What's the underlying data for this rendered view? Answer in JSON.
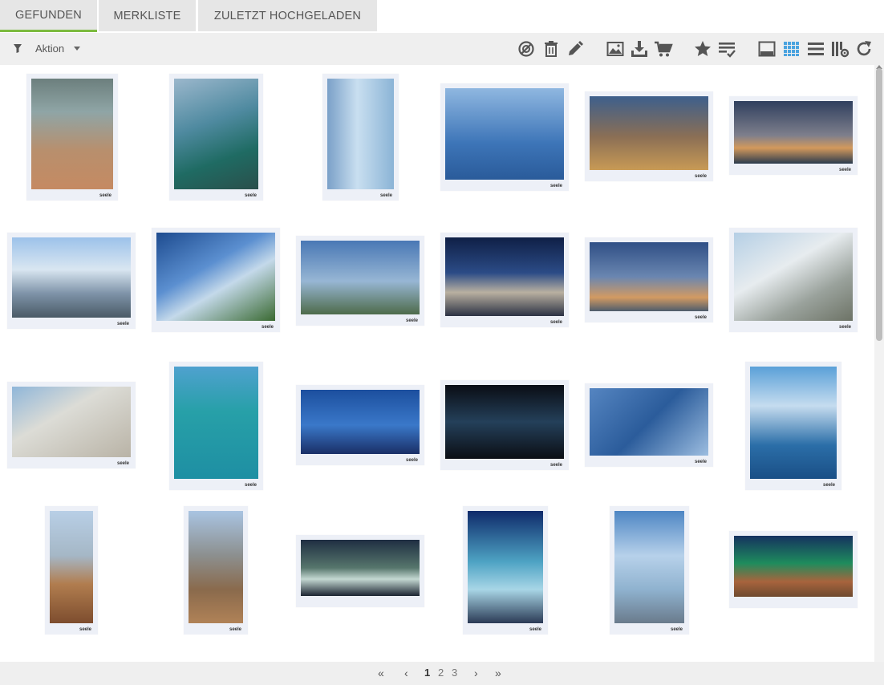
{
  "tabs": [
    {
      "label": "GEFUNDEN",
      "active": true
    },
    {
      "label": "MERKLISTE",
      "active": false
    },
    {
      "label": "ZULETZT HOCHGELADEN",
      "active": false
    }
  ],
  "toolbar": {
    "action_label": "Aktion",
    "icons": [
      "filter-icon",
      "deselect-icon",
      "trash-icon",
      "edit-icon",
      "image-icon",
      "download-icon",
      "cart-icon",
      "star-icon",
      "checklist-icon",
      "large-view-icon",
      "grid-view-icon",
      "list-view-icon",
      "columns-settings-icon",
      "refresh-icon"
    ]
  },
  "colors": {
    "tab_active_underline": "#7cbb3f",
    "icon_active": "#4aa3df",
    "icon": "#555555"
  },
  "thumbnails": [
    {
      "logo": "seele",
      "bg": "linear-gradient(180deg,#6c7f7d 0%,#8fa5a6 30%,#b88f6d 65%,#c58a62 100%)"
    },
    {
      "logo": "seele",
      "bg": "linear-gradient(160deg,#9bb7cc 0%,#4f8aa0 40%,#1f6b63 70%,#2a4f4b 100%)"
    },
    {
      "logo": "seele",
      "bg": "linear-gradient(90deg,#7aa0c8 0%,#c9dff0 45%,#8bb4d6 100%)"
    },
    {
      "logo": "seele",
      "bg": "linear-gradient(180deg,#8fb7e0 0%,#3d75b8 60%,#2a5b9a 100%)"
    },
    {
      "logo": "seele",
      "bg": "linear-gradient(180deg,#3d5f8c 0%,#8b6f55 55%,#c89a55 100%)"
    },
    {
      "logo": "seele",
      "bg": "linear-gradient(180deg,#2f3f5e 0%,#7e7f8c 55%,#d3995c 75%,#2b3b4e 100%)"
    },
    {
      "logo": "seele",
      "bg": "linear-gradient(180deg,#9cc2ea 0%,#d9e6f1 40%,#7e93a8 70%,#4a5a66 100%)"
    },
    {
      "logo": "seele",
      "bg": "linear-gradient(150deg,#1d4b8f 0%,#5b8fd0 40%,#c4d9ea 60%,#3a6a32 100%)"
    },
    {
      "logo": "seele",
      "bg": "linear-gradient(180deg,#4978b5 0%,#97b6d4 55%,#4e6b4a 100%)"
    },
    {
      "logo": "seele",
      "bg": "linear-gradient(180deg,#0f1f46 0%,#2b4b86 45%,#b9b0a0 70%,#2c3244 100%)"
    },
    {
      "logo": "seele",
      "bg": "linear-gradient(180deg,#2f4f86 0%,#6a86b0 50%,#d29a62 80%,#4e5c6c 100%)"
    },
    {
      "logo": "seele",
      "bg": "linear-gradient(150deg,#b5cfe5 0%,#e7ecef 40%,#9aa29c 70%,#6d7366 100%)"
    },
    {
      "logo": "seele",
      "bg": "linear-gradient(150deg,#8fb6d9 0%,#dcdcd6 40%,#b9b3a6 100%)"
    },
    {
      "logo": "seele",
      "bg": "linear-gradient(180deg,#4fa1cf 0%,#27a0a8 40%,#1e8fa3 100%)"
    },
    {
      "logo": "seele",
      "bg": "linear-gradient(180deg,#1c4f9e 0%,#3a78c9 55%,#1a2f66 100%)"
    },
    {
      "logo": "seele",
      "bg": "linear-gradient(180deg,#0a0d14 0%,#24405a 50%,#0b0e14 100%)"
    },
    {
      "logo": "seele",
      "bg": "linear-gradient(135deg,#5585c1 0%,#2b5c9b 50%,#9cbde0 100%)"
    },
    {
      "logo": "seele",
      "bg": "linear-gradient(180deg,#5aa0d8 0%,#c5dcef 35%,#2b6ea8 70%,#1a4f86 100%)"
    },
    {
      "logo": "seele",
      "bg": "linear-gradient(180deg,#b8cfe6 0%,#a5b7c6 40%,#b17d4f 65%,#7d4d2e 100%)"
    },
    {
      "logo": "seele",
      "bg": "linear-gradient(180deg,#a9c4e2 0%,#8c8f8e 40%,#8a6a4c 70%,#b08257 100%)"
    },
    {
      "logo": "",
      "bg": "linear-gradient(180deg,#1f2e42 0%,#56766c 50%,#c4d8d2 70%,#1b2430 100%)"
    },
    {
      "logo": "seele",
      "bg": "linear-gradient(180deg,#0f2a6a 0%,#4da2c3 45%,#a8d6e6 70%,#2b3a55 100%)"
    },
    {
      "logo": "seele",
      "bg": "linear-gradient(180deg,#4e86c4 0%,#b7d1ea 40%,#8fb2cf 70%,#6a7b8c 100%)"
    },
    {
      "logo": "",
      "bg": "linear-gradient(180deg,#15325f 0%,#1e8c5d 45%,#a8643d 75%,#6e4a2f 100%)"
    }
  ],
  "pagination": {
    "first": "«",
    "prev": "‹",
    "pages": [
      "1",
      "2",
      "3"
    ],
    "current": "1",
    "next": "›",
    "last": "»"
  }
}
